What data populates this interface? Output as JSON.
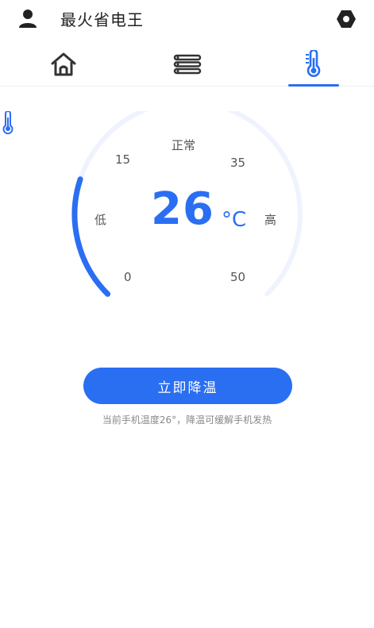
{
  "header": {
    "title": "最火省电王",
    "avatar_icon": "user-icon",
    "settings_icon": "gear-icon"
  },
  "tabs": [
    {
      "name": "home",
      "icon": "home-icon",
      "active": false
    },
    {
      "name": "list",
      "icon": "list-icon",
      "active": false
    },
    {
      "name": "temperature",
      "icon": "thermometer-icon",
      "active": true
    }
  ],
  "gauge": {
    "status": "正常",
    "low_label": "低",
    "high_label": "高",
    "ticks": {
      "t0": "0",
      "t15": "15",
      "t35": "35",
      "t50": "50"
    },
    "value": "26",
    "unit": "°C",
    "range": [
      0,
      50
    ],
    "current": 26
  },
  "action": {
    "button_label": "立即降温",
    "hint": "当前手机温度26°，降温可缓解手机发热"
  },
  "colors": {
    "accent": "#2a6ef2",
    "track": "#eef3fd"
  }
}
